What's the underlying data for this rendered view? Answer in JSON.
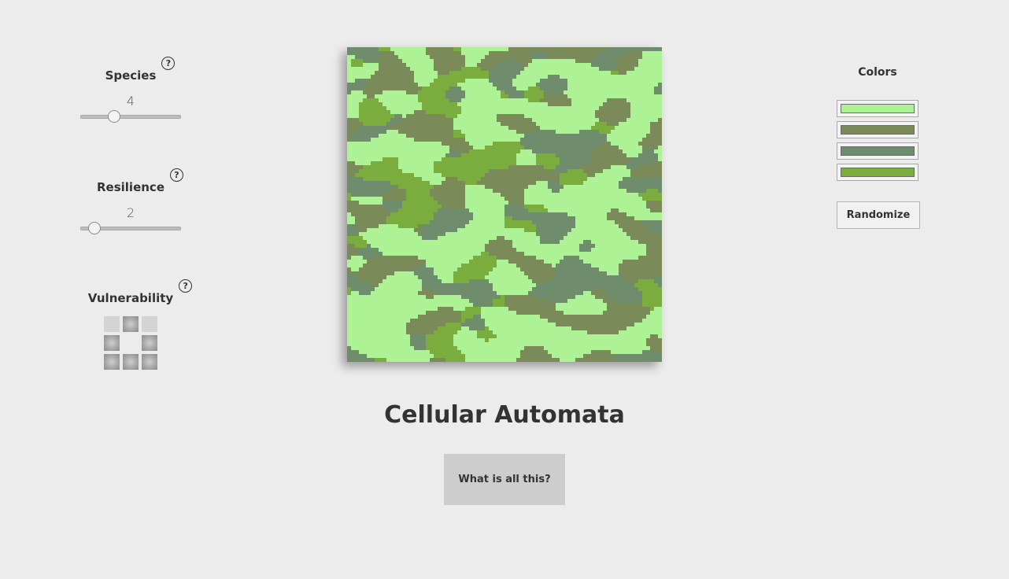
{
  "controls": {
    "species": {
      "label": "Species",
      "value": "4",
      "min": 2,
      "max": 8,
      "level": 4
    },
    "resilience": {
      "label": "Resilience",
      "value": "2",
      "min": 1,
      "max": 8,
      "level": 2
    },
    "vulnerability": {
      "label": "Vulnerability",
      "grid": [
        [
          false,
          true,
          false
        ],
        [
          true,
          null,
          true
        ],
        [
          true,
          true,
          true
        ]
      ]
    },
    "help_glyph": "?"
  },
  "title": "Cellular Automata",
  "about_button": "What is all this?",
  "colors": {
    "label": "Colors",
    "swatches": [
      "#aef296",
      "#7b8a59",
      "#6f8c6c",
      "#7aad3d"
    ]
  },
  "randomize_button": "Randomize"
}
